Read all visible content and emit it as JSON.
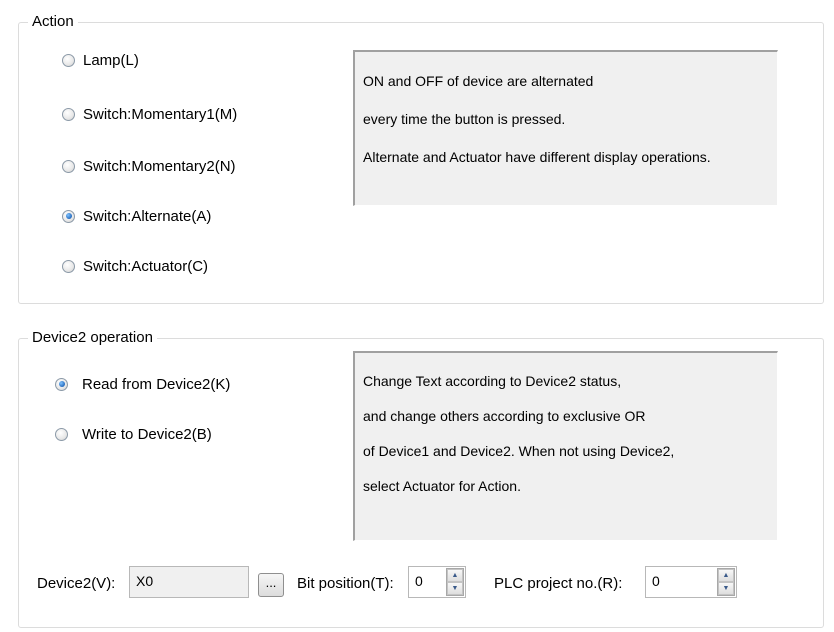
{
  "action": {
    "title": "Action",
    "options": [
      {
        "label": "Lamp(L)",
        "checked": false
      },
      {
        "label": "Switch:Momentary1(M)",
        "checked": false
      },
      {
        "label": "Switch:Momentary2(N)",
        "checked": false
      },
      {
        "label": "Switch:Alternate(A)",
        "checked": true
      },
      {
        "label": "Switch:Actuator(C)",
        "checked": false
      }
    ],
    "description": [
      "ON and OFF of device are alternated",
      "every time the button is pressed.",
      "Alternate and Actuator have different display operations."
    ]
  },
  "device2_operation": {
    "title": "Device2 operation",
    "options": [
      {
        "label": "Read from Device2(K)",
        "checked": true
      },
      {
        "label": "Write to Device2(B)",
        "checked": false
      }
    ],
    "description": [
      "Change Text according to Device2 status,",
      "and change others according to exclusive OR",
      "of Device1 and Device2. When not using Device2,",
      "select Actuator for Action."
    ]
  },
  "device2_field": {
    "label": "Device2(V):",
    "value": "X0",
    "browse_label": "..."
  },
  "bit_position": {
    "label": "Bit position(T):",
    "value": "0"
  },
  "plc_project": {
    "label": "PLC project no.(R):",
    "value": "0"
  },
  "icons": {
    "spin_up": "spin-up-arrow-icon",
    "spin_down": "spin-down-arrow-icon"
  }
}
